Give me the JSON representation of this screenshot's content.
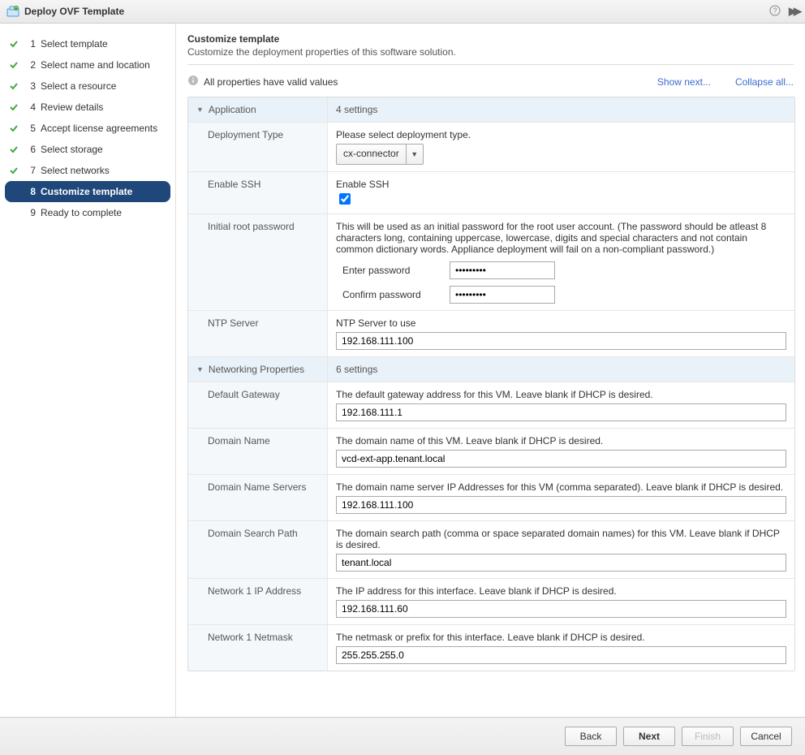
{
  "titlebar": {
    "title": "Deploy OVF Template"
  },
  "sidebar": {
    "steps": [
      {
        "num": "1",
        "label": "Select template",
        "done": true
      },
      {
        "num": "2",
        "label": "Select name and location",
        "done": true
      },
      {
        "num": "3",
        "label": "Select a resource",
        "done": true
      },
      {
        "num": "4",
        "label": "Review details",
        "done": true
      },
      {
        "num": "5",
        "label": "Accept license agreements",
        "done": true
      },
      {
        "num": "6",
        "label": "Select storage",
        "done": true
      },
      {
        "num": "7",
        "label": "Select networks",
        "done": true
      },
      {
        "num": "8",
        "label": "Customize template",
        "active": true
      },
      {
        "num": "9",
        "label": "Ready to complete",
        "incomplete": true
      }
    ]
  },
  "main": {
    "heading": "Customize template",
    "subheading": "Customize the deployment properties of this software solution.",
    "status_text": "All properties have valid values",
    "show_next": "Show next...",
    "collapse_all": "Collapse all...",
    "sections": {
      "application": {
        "title": "Application",
        "summary": "4 settings",
        "deployment_type": {
          "label": "Deployment Type",
          "desc": "Please select deployment type.",
          "value": "cx-connector"
        },
        "enable_ssh": {
          "label": "Enable SSH",
          "desc": "Enable SSH",
          "checked": true
        },
        "initial_root_password": {
          "label": "Initial root password",
          "desc": "This will be used as an initial password for the root user account. (The password should be atleast 8 characters long, containing uppercase, lowercase, digits and special characters and not contain common dictionary words. Appliance deployment will fail on a non-compliant password.)",
          "enter_label": "Enter password",
          "confirm_label": "Confirm password",
          "value": "*********",
          "confirm_value": "*********"
        },
        "ntp_server": {
          "label": "NTP Server",
          "desc": "NTP Server to use",
          "value": "192.168.111.100"
        }
      },
      "networking": {
        "title": "Networking Properties",
        "summary": "6 settings",
        "default_gateway": {
          "label": "Default Gateway",
          "desc": "The default gateway address for this VM. Leave blank if DHCP is desired.",
          "value": "192.168.111.1"
        },
        "domain_name": {
          "label": "Domain Name",
          "desc": "The domain name of this VM. Leave blank if DHCP is desired.",
          "value": "vcd-ext-app.tenant.local"
        },
        "domain_name_servers": {
          "label": "Domain Name Servers",
          "desc": "The domain name server IP Addresses for this VM (comma separated). Leave blank if DHCP is desired.",
          "value": "192.168.111.100"
        },
        "domain_search_path": {
          "label": "Domain Search Path",
          "desc": "The domain search path (comma or space separated domain names) for this VM. Leave blank if DHCP is desired.",
          "value": "tenant.local"
        },
        "network1_ip": {
          "label": "Network 1 IP Address",
          "desc": "The IP address for this interface. Leave blank if DHCP is desired.",
          "value": "192.168.111.60"
        },
        "network1_netmask": {
          "label": "Network 1 Netmask",
          "desc": "The netmask or prefix for this interface. Leave blank if DHCP is desired.",
          "value": "255.255.255.0"
        }
      }
    }
  },
  "footer": {
    "back": "Back",
    "next": "Next",
    "finish": "Finish",
    "cancel": "Cancel"
  }
}
